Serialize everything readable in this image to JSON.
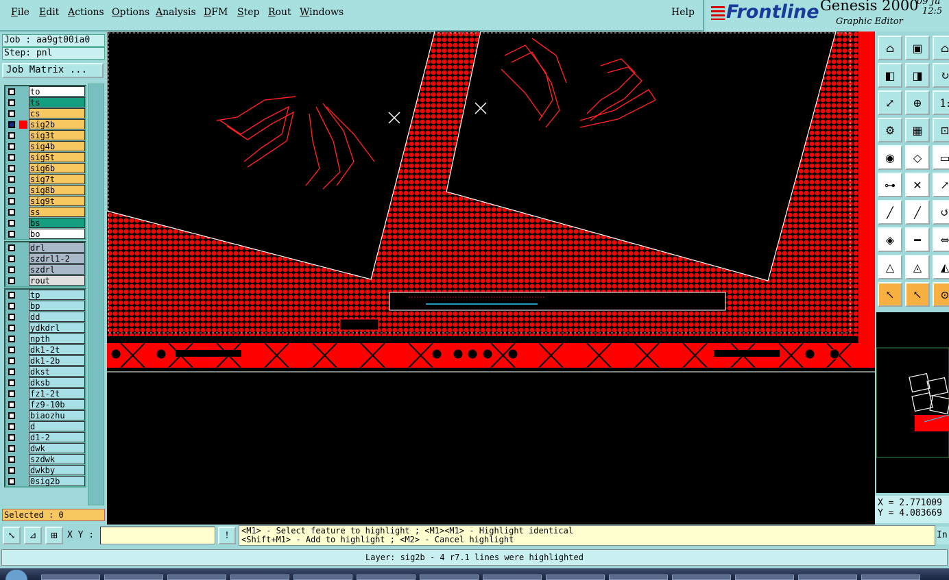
{
  "menubar": {
    "items": [
      "File",
      "Edit",
      "Actions",
      "Options",
      "Analysis",
      "DFM",
      "Step",
      "Rout",
      "Windows"
    ],
    "help": "Help"
  },
  "brand": {
    "logo": "Frontline",
    "product": "Genesis 2000",
    "subtitle": "Graphic Editor",
    "date": "09 Ju",
    "time": "12:5"
  },
  "job": {
    "job_label": "Job : aa9gt00ia0",
    "step_label": "Step: pnl",
    "matrix_button": "Job Matrix ..."
  },
  "layers": {
    "board": [
      {
        "name": "to",
        "color": "#ffffff"
      },
      {
        "name": "ts",
        "color": "#14a080"
      },
      {
        "name": "cs",
        "color": "#f8c860"
      },
      {
        "name": "sig2b",
        "color": "#f8c860",
        "active": true
      },
      {
        "name": "sig3t",
        "color": "#f8c860"
      },
      {
        "name": "sig4b",
        "color": "#f8c860"
      },
      {
        "name": "sig5t",
        "color": "#f8c860"
      },
      {
        "name": "sig6b",
        "color": "#f8c860"
      },
      {
        "name": "sig7t",
        "color": "#f8c860"
      },
      {
        "name": "sig8b",
        "color": "#f8c860"
      },
      {
        "name": "sig9t",
        "color": "#f8c860"
      },
      {
        "name": "ss",
        "color": "#f8c860"
      },
      {
        "name": "bs",
        "color": "#14a080"
      },
      {
        "name": "bo",
        "color": "#ffffff"
      }
    ],
    "drill": [
      {
        "name": "drl",
        "color": "#a8b8c8"
      },
      {
        "name": "szdrl1-2",
        "color": "#a8b8c8"
      },
      {
        "name": "szdrl",
        "color": "#a8b8c8"
      },
      {
        "name": "rout",
        "color": "#e0e0e0"
      }
    ],
    "misc": [
      {
        "name": "tp",
        "color": "#a8e0e8"
      },
      {
        "name": "bp",
        "color": "#a8e0e8"
      },
      {
        "name": "dd",
        "color": "#a8e0e8"
      },
      {
        "name": "ydkdrl",
        "color": "#a8e0e8"
      },
      {
        "name": "npth",
        "color": "#a8e0e8"
      },
      {
        "name": "dk1-2t",
        "color": "#a8e0e8"
      },
      {
        "name": "dk1-2b",
        "color": "#a8e0e8"
      },
      {
        "name": "dkst",
        "color": "#a8e0e8"
      },
      {
        "name": "dksb",
        "color": "#a8e0e8"
      },
      {
        "name": "fz1-2t",
        "color": "#a8e0e8"
      },
      {
        "name": "fz9-10b",
        "color": "#a8e0e8"
      },
      {
        "name": "biaozhu",
        "color": "#a8e0e8"
      },
      {
        "name": "d",
        "color": "#a8e0e8"
      },
      {
        "name": "d1-2",
        "color": "#a8e0e8"
      },
      {
        "name": "dwk",
        "color": "#a8e0e8"
      },
      {
        "name": "szdwk",
        "color": "#a8e0e8"
      },
      {
        "name": "dwkby",
        "color": "#a8e0e8"
      },
      {
        "name": "0sig2b",
        "color": "#a8e0e8"
      }
    ]
  },
  "selected": "Selected : 0",
  "coords": {
    "x": "X = 2.771009",
    "y": "Y = 4.083669"
  },
  "statusbar": {
    "xy_label": "X Y :",
    "xy_value": "",
    "info_button": "!",
    "hint_line1": "<M1> - Select feature to highlight ; <M1><M1> - Highlight identical",
    "hint_line2": "<Shift+M1> - Add to highlight ; <M2> - Cancel highlight",
    "hint_right": "In"
  },
  "message": "Layer: sig2b - 4 r7.1 lines were highlighted",
  "tools": [
    "top-view-icon",
    "save-view-icon",
    "zoom-home-icon",
    "pan-left-icon",
    "pan-right-icon",
    "redraw-icon",
    "zoom-fit-icon",
    "zoom-in-icon",
    "ratio-icon",
    "measure-icon",
    "grid-icon",
    "snap-icon",
    "select-pad-icon",
    "add-shape-icon",
    "ruler-icon",
    "connect-icon",
    "delete-icon",
    "move-icon",
    "line-icon",
    "edit-line-icon",
    "rotate-icon",
    "pad-icon",
    "split-icon",
    "stretch-icon",
    "triangle-icon",
    "arc-icon",
    "arc2-icon",
    "pointer-icon",
    "select-arrow-icon",
    "zoom-select-icon"
  ],
  "colors": {
    "board": "#ff0000",
    "background": "#000000",
    "accent_panel": "#9ed8d8"
  }
}
